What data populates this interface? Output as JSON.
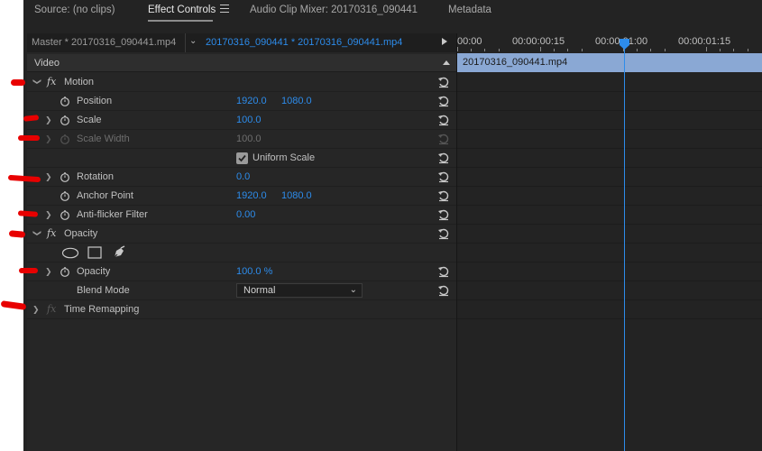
{
  "tabs": {
    "source": "Source: (no clips)",
    "effect_controls": "Effect Controls",
    "audio_mixer": "Audio Clip Mixer: 20170316_090441",
    "metadata": "Metadata"
  },
  "clip_bar": {
    "master": "Master * 20170316_090441.mp4",
    "sequence": "20170316_090441 * 20170316_090441.mp4"
  },
  "section": {
    "video": "Video"
  },
  "rows": {
    "motion": {
      "label": "Motion"
    },
    "position": {
      "label": "Position",
      "x": "1920.0",
      "y": "1080.0"
    },
    "scale": {
      "label": "Scale",
      "value": "100.0"
    },
    "scale_width": {
      "label": "Scale Width",
      "value": "100.0"
    },
    "uniform_scale": {
      "label": "Uniform Scale",
      "checked": true
    },
    "rotation": {
      "label": "Rotation",
      "value": "0.0"
    },
    "anchor_point": {
      "label": "Anchor Point",
      "x": "1920.0",
      "y": "1080.0"
    },
    "anti_flicker": {
      "label": "Anti-flicker Filter",
      "value": "0.00"
    },
    "opacity_group": {
      "label": "Opacity"
    },
    "opacity": {
      "label": "Opacity",
      "value": "100.0 %"
    },
    "blend_mode": {
      "label": "Blend Mode",
      "value": "Normal"
    },
    "time_remapping": {
      "label": "Time Remapping"
    }
  },
  "timeline": {
    "ticks": [
      "00:00",
      "00:00:00:15",
      "00:00:01:00",
      "00:00:01:15"
    ],
    "clip_name": "20170316_090441.mp4"
  },
  "colors": {
    "accent": "#2d8ceb",
    "clip": "#8aa8d4",
    "annotation": "#e80000"
  }
}
